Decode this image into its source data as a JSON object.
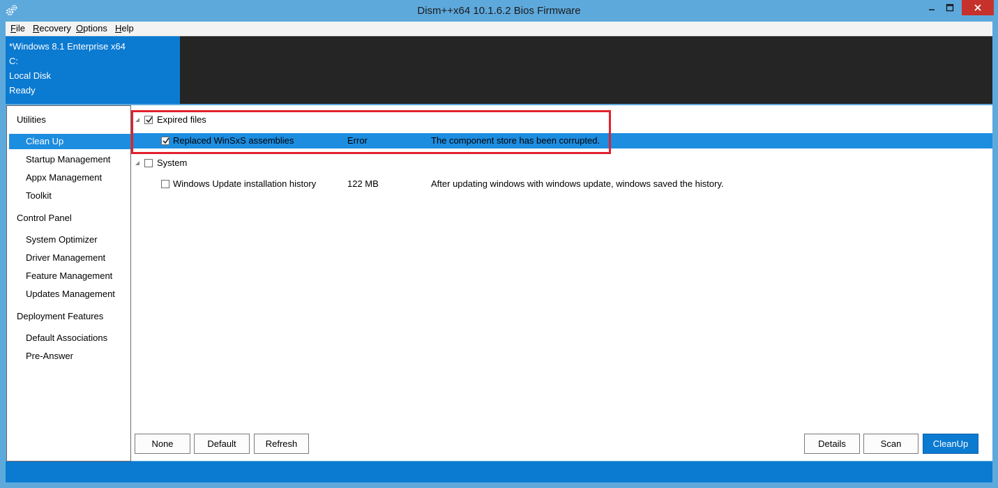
{
  "window": {
    "title": "Dism++x64 10.1.6.2 Bios Firmware",
    "controls": {
      "minimize": "–",
      "maximize": "□",
      "close": "✕"
    },
    "icon": "gears-icon"
  },
  "menu": {
    "items": [
      {
        "label": "File",
        "underline": "F",
        "rest": "ile"
      },
      {
        "label": "Recovery",
        "underline": "R",
        "rest": "ecovery"
      },
      {
        "label": "Options",
        "underline": "O",
        "rest": "ptions"
      },
      {
        "label": "Help",
        "underline": "H",
        "rest": "elp"
      }
    ]
  },
  "image_info": {
    "os": "*Windows 8.1 Enterprise x64",
    "drive": "C:",
    "disk": "Local Disk",
    "status": "Ready"
  },
  "sidebar": {
    "groups": [
      {
        "label": "Utilities",
        "items": [
          "Clean Up",
          "Startup Management",
          "Appx Management",
          "Toolkit"
        ]
      },
      {
        "label": "Control Panel",
        "items": [
          "System Optimizer",
          "Driver Management",
          "Feature Management",
          "Updates Management"
        ]
      },
      {
        "label": "Deployment Features",
        "items": [
          "Default Associations",
          "Pre-Answer"
        ]
      }
    ],
    "selected": "Clean Up"
  },
  "cleanup_tree": {
    "groups": [
      {
        "label": "Expired files",
        "checked": true,
        "items": [
          {
            "name": "Replaced WinSxS assemblies",
            "size": "Error",
            "description": "The component store has been corrupted.",
            "checked": true,
            "selected": true
          }
        ]
      },
      {
        "label": "System",
        "checked": false,
        "items": [
          {
            "name": "Windows Update installation history",
            "size": "122 MB",
            "description": "After updating windows with windows update, windows saved the history.",
            "checked": false,
            "selected": false
          }
        ]
      }
    ]
  },
  "buttons": {
    "none": "None",
    "default": "Default",
    "refresh": "Refresh",
    "details": "Details",
    "scan": "Scan",
    "cleanup": "CleanUp"
  },
  "colors": {
    "titlebar": "#5ea9dc",
    "accent": "#0b7ad1",
    "selection": "#1d8de0",
    "highlight": "#e2202d",
    "close": "#c7312b"
  }
}
